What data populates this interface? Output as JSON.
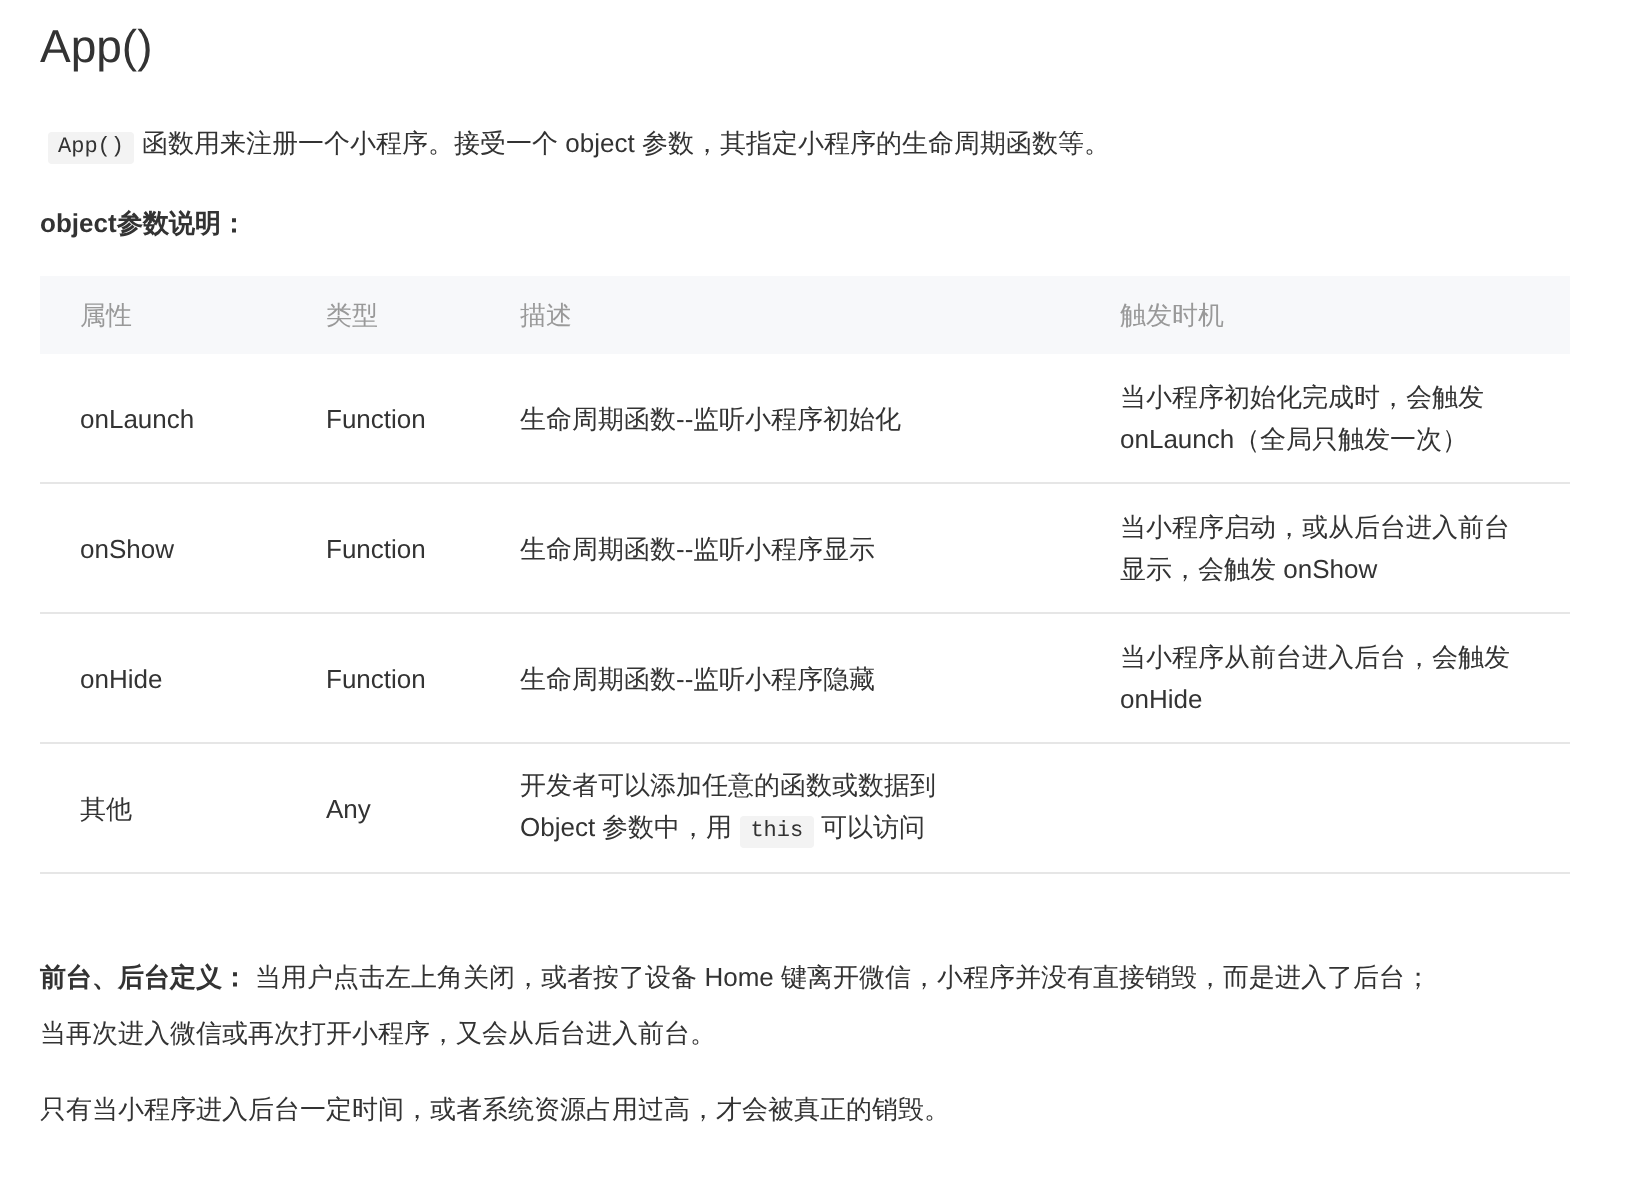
{
  "title": "App()",
  "intro": [
    {
      "kind": "code",
      "text": "App()"
    },
    {
      "kind": "text",
      "text": "函数用来注册一个小程序。接受一个 object 参数，其指定小程序的生命周期函数等。"
    }
  ],
  "subheading": "object参数说明：",
  "table": {
    "columns": [
      "属性",
      "类型",
      "描述",
      "触发时机"
    ],
    "rows": [
      [
        [
          {
            "kind": "text",
            "text": "onLaunch"
          }
        ],
        [
          {
            "kind": "text",
            "text": "Function"
          }
        ],
        [
          {
            "kind": "text",
            "text": "生命周期函数--监听小程序初始化"
          }
        ],
        [
          {
            "kind": "text",
            "text": "当小程序初始化完成时，会触发 onLaunch（全局只触发一次）"
          }
        ]
      ],
      [
        [
          {
            "kind": "text",
            "text": "onShow"
          }
        ],
        [
          {
            "kind": "text",
            "text": "Function"
          }
        ],
        [
          {
            "kind": "text",
            "text": "生命周期函数--监听小程序显示"
          }
        ],
        [
          {
            "kind": "text",
            "text": "当小程序启动，或从后台进入前台显示，会触发 onShow"
          }
        ]
      ],
      [
        [
          {
            "kind": "text",
            "text": "onHide"
          }
        ],
        [
          {
            "kind": "text",
            "text": "Function"
          }
        ],
        [
          {
            "kind": "text",
            "text": "生命周期函数--监听小程序隐藏"
          }
        ],
        [
          {
            "kind": "text",
            "text": "当小程序从前台进入后台，会触发 onHide"
          }
        ]
      ],
      [
        [
          {
            "kind": "text",
            "text": "其他"
          }
        ],
        [
          {
            "kind": "text",
            "text": "Any"
          }
        ],
        [
          {
            "kind": "text",
            "text": "开发者可以添加任意的函数或数据到 Object 参数中，用"
          },
          {
            "kind": "code",
            "text": "this"
          },
          {
            "kind": "text",
            "text": "可以访问"
          }
        ],
        []
      ]
    ]
  },
  "definition": "**前台、后台定义：** 当用户点击左上角关闭，或者按了设备 Home 键离开微信，小程序并没有直接销毁，而是进入了后台；当再次进入微信或再次打开小程序，又会从后台进入前台。",
  "note": "只有当小程序进入后台一定时间，或者系统资源占用过高，才会被真正的销毁。"
}
